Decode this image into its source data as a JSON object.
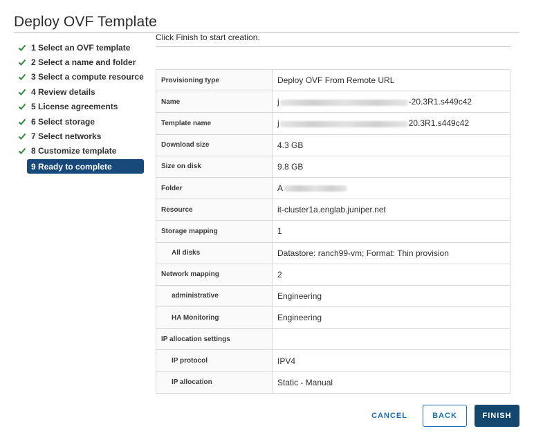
{
  "dialog": {
    "title": "Deploy OVF Template"
  },
  "steps": [
    {
      "label": "1 Select an OVF template",
      "done": true
    },
    {
      "label": "2 Select a name and folder",
      "done": true
    },
    {
      "label": "3 Select a compute resource",
      "done": true
    },
    {
      "label": "4 Review details",
      "done": true
    },
    {
      "label": "5 License agreements",
      "done": true
    },
    {
      "label": "6 Select storage",
      "done": true
    },
    {
      "label": "7 Select networks",
      "done": true
    },
    {
      "label": "8 Customize template",
      "done": true
    },
    {
      "label": "9 Ready to complete",
      "done": false,
      "active": true
    }
  ],
  "intro": "Click Finish to start creation.",
  "summary": [
    {
      "key": "Provisioning type",
      "value": "Deploy OVF From Remote URL"
    },
    {
      "key": "Name",
      "value_prefix": "j",
      "value": "-20.3R1.s449c42",
      "blurred": true
    },
    {
      "key": "Template name",
      "value_prefix": "j",
      "value": "20.3R1.s449c42",
      "blurred": true
    },
    {
      "key": "Download size",
      "value": "4.3 GB"
    },
    {
      "key": "Size on disk",
      "value": "9.8 GB"
    },
    {
      "key": "Folder",
      "value_prefix": "A",
      "value": "",
      "blurred": true
    },
    {
      "key": "Resource",
      "value": "it-cluster1a.englab.juniper.net"
    },
    {
      "key": "Storage mapping",
      "value": "1"
    },
    {
      "key": "All disks",
      "value": "Datastore: ranch99-vm; Format: Thin provision",
      "sub": true
    },
    {
      "key": "Network mapping",
      "value": "2"
    },
    {
      "key": "administrative",
      "value": "Engineering",
      "sub": true
    },
    {
      "key": "HA Monitoring",
      "value": "Engineering",
      "sub": true
    },
    {
      "key": "IP allocation settings",
      "value": ""
    },
    {
      "key": "IP protocol",
      "value": "IPV4",
      "sub": true
    },
    {
      "key": "IP allocation",
      "value": "Static - Manual",
      "sub": true
    }
  ],
  "buttons": {
    "cancel": "CANCEL",
    "back": "BACK",
    "finish": "FINISH"
  },
  "colors": {
    "check": "#2e8b3a",
    "active_step": "#17497a",
    "primary": "#13476d",
    "link": "#1b6eae"
  }
}
